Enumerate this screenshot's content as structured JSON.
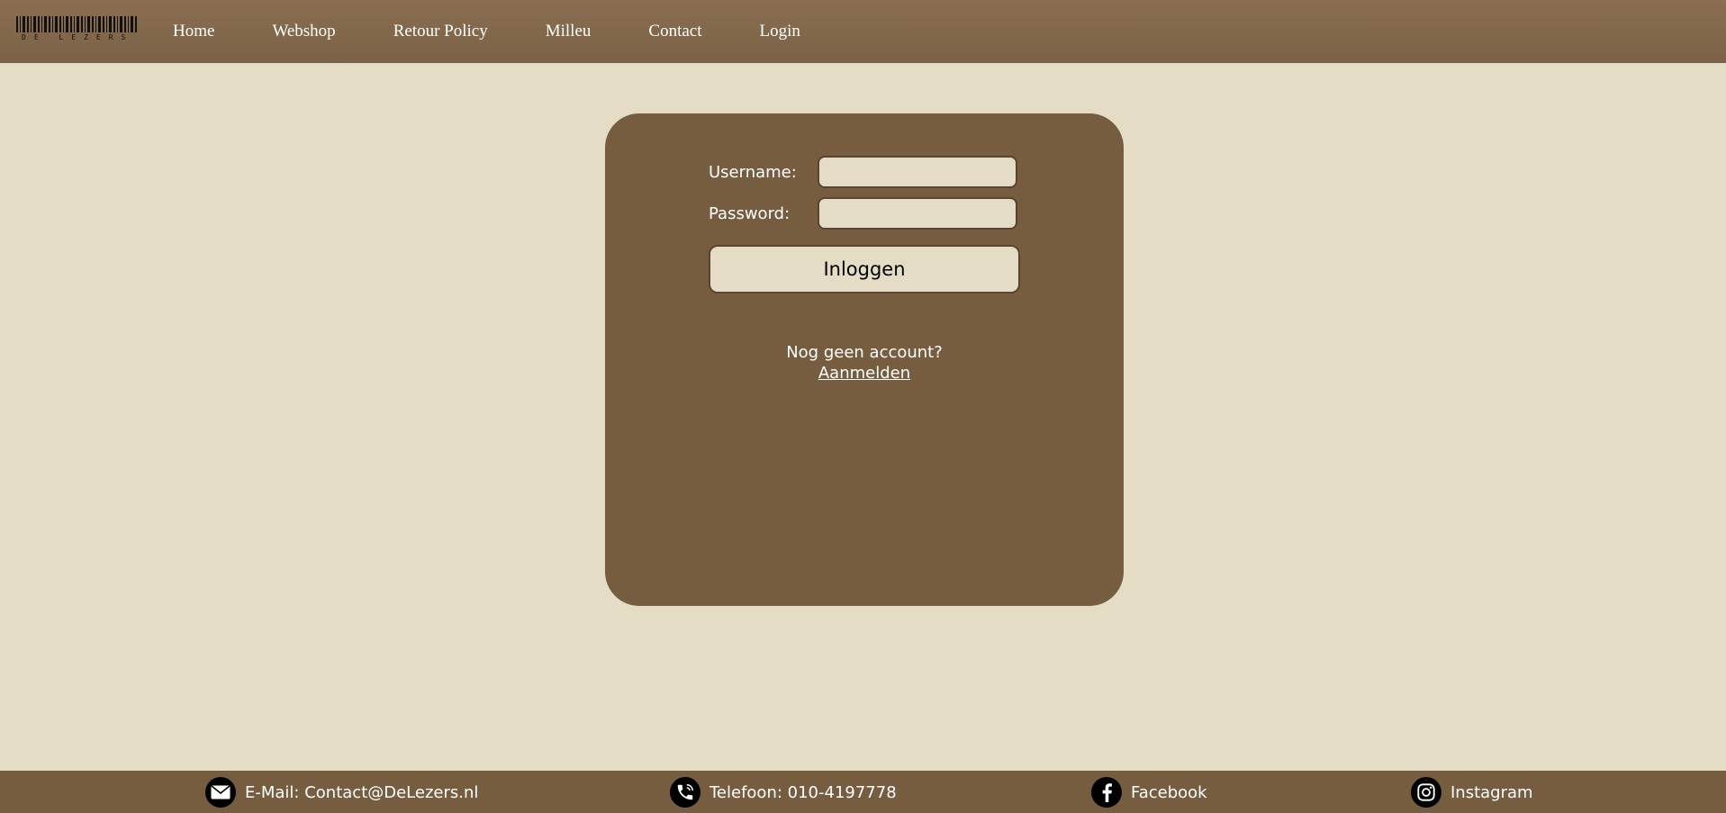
{
  "brand": {
    "logo_text": "DE LEZERS"
  },
  "nav": {
    "items": [
      "Home",
      "Webshop",
      "Retour Policy",
      "Milleu",
      "Contact",
      "Login"
    ]
  },
  "login": {
    "username_label": "Username:",
    "username_value": "",
    "password_label": "Password:",
    "password_value": "",
    "submit_label": "Inloggen",
    "no_account_text": "Nog geen account?",
    "signup_link": "Aanmelden"
  },
  "footer": {
    "email": {
      "text": "E-Mail: Contact@DeLezers.nl",
      "icon": "mail-icon"
    },
    "phone": {
      "text": "Telefoon: 010-4197778",
      "icon": "phone-icon"
    },
    "facebook": {
      "text": "Facebook",
      "icon": "facebook-icon"
    },
    "instagram": {
      "text": "Instagram",
      "icon": "instagram-icon"
    }
  },
  "colors": {
    "header_bg": "#8a6f52",
    "page_bg": "#e4dcc5",
    "card_bg": "#775d40",
    "footer_bg": "#775d40"
  }
}
